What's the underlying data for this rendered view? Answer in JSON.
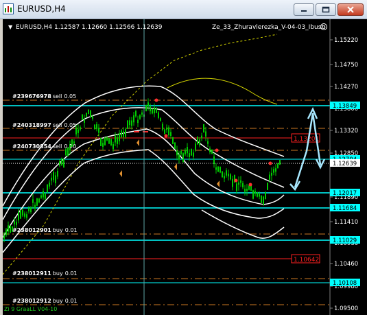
{
  "window": {
    "title": "EURUSD,H4",
    "minimize_icon": "minimize-icon",
    "maximize_icon": "maximize-icon",
    "close_icon": "close-icon"
  },
  "chart": {
    "symbol_line": "EURUSD,H4  1.12587 1.12660 1.12566 1.12639",
    "indicator_label": "Ze_33_Zhuravlerezka_V-04-03_Ibush",
    "face_icon": "smiley-face-icon",
    "bottom_label": "Zi 9 GraaLL V04-10",
    "colors": {
      "background": "#000000",
      "candle": "#00cc00",
      "band": "#ffffff",
      "cyan": "#00ffff",
      "orange": "#cc7722",
      "red": "#ff2020",
      "yellow": "#d8d800"
    }
  },
  "price_axis": {
    "labels": [
      "1.15220",
      "1.14750",
      "1.14270",
      "1.13800",
      "1.13320",
      "1.12850",
      "1.12375",
      "1.11890",
      "1.11410",
      "1.10930",
      "1.10460",
      "1.09980",
      "1.09500"
    ],
    "badges": [
      {
        "text": "1.13849",
        "style": "cyan"
      },
      {
        "text": "1.12704",
        "style": "cyan"
      },
      {
        "text": "1.12639",
        "style": "white"
      },
      {
        "text": "1.12017",
        "style": "cyan"
      },
      {
        "text": "1.11684",
        "style": "cyan"
      },
      {
        "text": "1.11029",
        "style": "cyan"
      },
      {
        "text": "1.10108",
        "style": "cyan"
      }
    ],
    "in_chart_badges": [
      {
        "text": "1.13201",
        "color": "red"
      },
      {
        "text": "1.10642",
        "color": "red"
      }
    ]
  },
  "order_labels": [
    {
      "ticket": "#239676978",
      "action": "sell",
      "lots": "0.05"
    },
    {
      "ticket": "#240318997",
      "action": "sell",
      "lots": "0.05"
    },
    {
      "ticket": "#240730854",
      "action": "sell",
      "lots": "0.10"
    },
    {
      "ticket": "#238012901",
      "action": "buy",
      "lots": "0.01"
    },
    {
      "ticket": "#238012911",
      "action": "buy",
      "lots": "0.01"
    },
    {
      "ticket": "#238012912",
      "action": "buy",
      "lots": "0.01"
    }
  ]
}
